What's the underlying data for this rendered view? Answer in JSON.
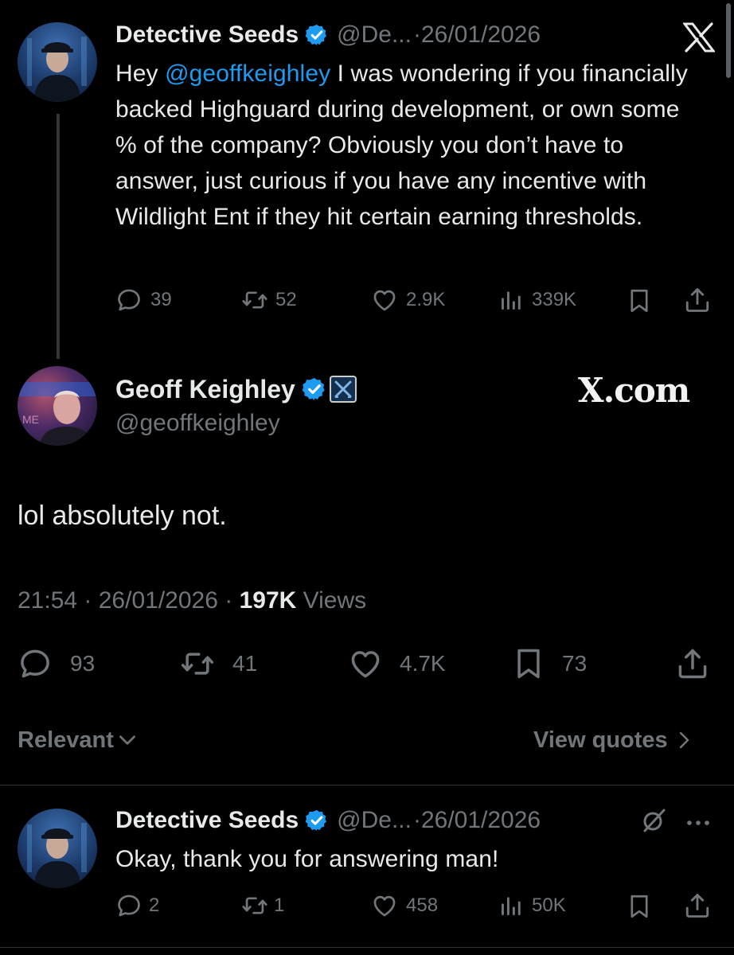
{
  "tweet1": {
    "display_name": "Detective Seeds",
    "handle": "@De...",
    "separator": "·",
    "date": "26/01/2026",
    "text_prefix": "Hey ",
    "mention": "@geoffkeighley",
    "text_rest": " I was wondering if you financially backed Highguard during development, or own some % of the company? Obviously you don’t have to answer, just curious if you have any incentive with Wildlight Ent if they hit certain earning thresholds.",
    "replies": "39",
    "reposts": "52",
    "likes": "2.9K",
    "views": "339K"
  },
  "main_tweet": {
    "display_name": "Geoff Keighley",
    "handle": "@geoffkeighley",
    "brand_text": "X.com",
    "text": "lol absolutely not.",
    "time": "21:54",
    "sep1": " · ",
    "date": "26/01/2026",
    "sep2": " · ",
    "views_count": "197K",
    "views_label": " Views",
    "replies": "93",
    "reposts": "41",
    "likes": "4.7K",
    "bookmarks": "73"
  },
  "controls": {
    "sort_label": "Relevant",
    "view_quotes_label": "View quotes"
  },
  "reply1": {
    "display_name": "Detective Seeds",
    "handle": "@De...",
    "separator": "·",
    "date": "26/01/2026",
    "text": "Okay, thank you for answering man!",
    "replies": "2",
    "reposts": "1",
    "likes": "458",
    "views": "50K"
  },
  "colors": {
    "background": "#000000",
    "text": "#e7e9ea",
    "muted": "#71767b",
    "accent": "#1d9bf0"
  },
  "icons": [
    "x-logo-icon",
    "verified-badge-icon",
    "affiliate-badge-icon",
    "reply-icon",
    "repost-icon",
    "like-icon",
    "views-icon",
    "bookmark-icon",
    "share-icon",
    "chevron-down-icon",
    "chevron-right-icon",
    "grok-icon",
    "more-icon"
  ]
}
